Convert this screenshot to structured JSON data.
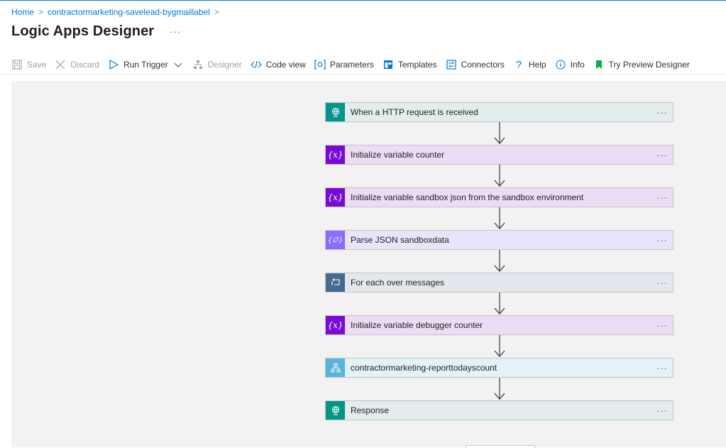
{
  "breadcrumb": {
    "home": "Home",
    "current": "contractormarketing-savelead-bygmaillabel"
  },
  "page": {
    "title": "Logic Apps Designer",
    "more": "···"
  },
  "toolbar": {
    "save": "Save",
    "discard": "Discard",
    "run_trigger": "Run Trigger",
    "designer": "Designer",
    "code_view": "Code view",
    "parameters": "Parameters",
    "templates": "Templates",
    "connectors": "Connectors",
    "help": "Help",
    "info": "Info",
    "try_preview": "Try Preview Designer"
  },
  "colors": {
    "accent": "#0078d4",
    "http_icon": "#009688",
    "variable_icon": "#770bd6",
    "parse_icon": "#8c6cff",
    "foreach_icon": "#486991",
    "workflow_icon": "#59b4d9",
    "preview_flag": "#00b050"
  },
  "steps": [
    {
      "label": "When a HTTP request is received",
      "icon": "http-globe-icon",
      "more": "···"
    },
    {
      "label": "Initialize variable counter",
      "icon": "variable-icon",
      "more": "···"
    },
    {
      "label": "Initialize variable sandbox json from the sandbox environment",
      "icon": "variable-icon",
      "more": "···"
    },
    {
      "label": "Parse JSON sandboxdata",
      "icon": "parse-json-icon",
      "more": "···"
    },
    {
      "label": "For each over messages",
      "icon": "foreach-loop-icon",
      "more": "···"
    },
    {
      "label": "Initialize variable debugger counter",
      "icon": "variable-icon",
      "more": "···"
    },
    {
      "label": "contractormarketing-reporttodayscount",
      "icon": "workflow-icon",
      "more": "···"
    },
    {
      "label": "Response",
      "icon": "http-globe-icon",
      "more": "···"
    }
  ]
}
